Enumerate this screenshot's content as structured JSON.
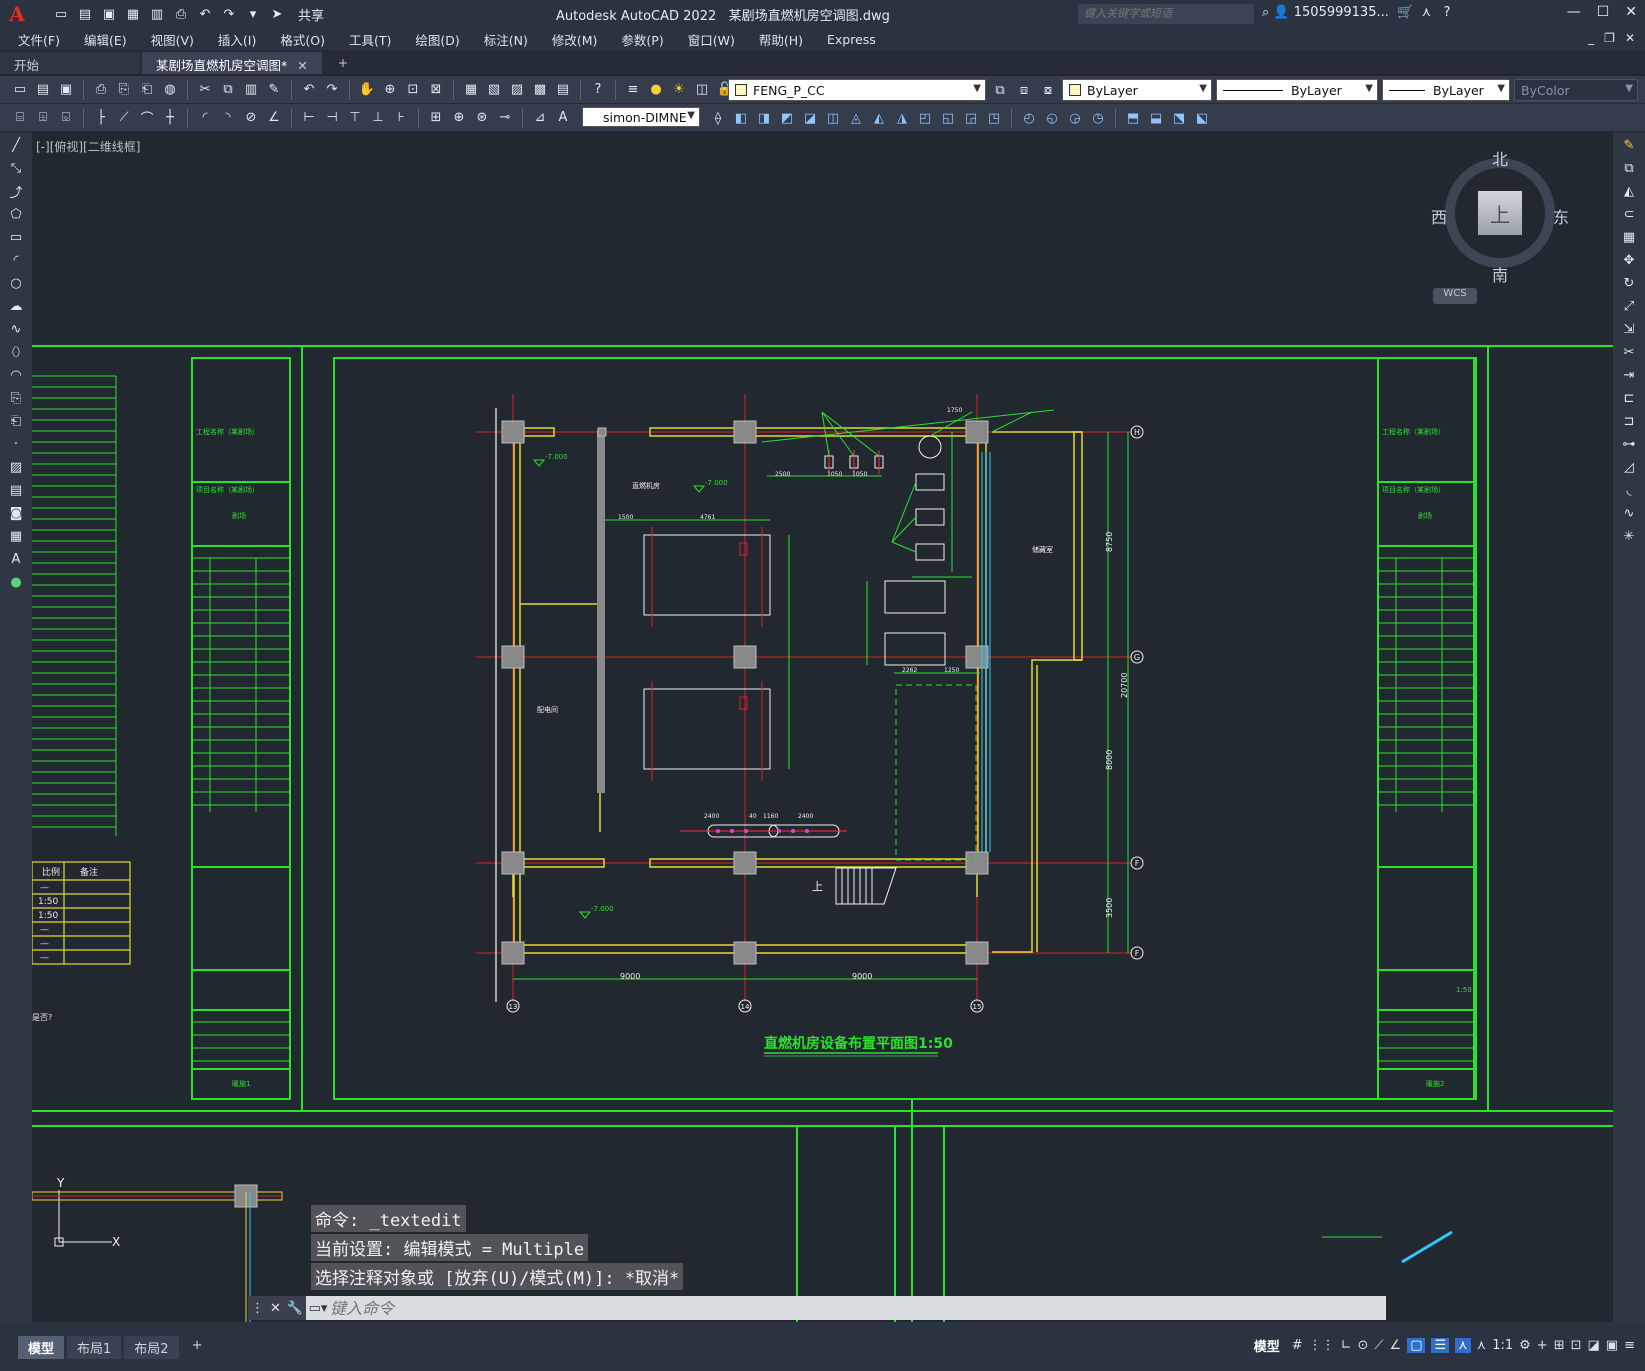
{
  "app": {
    "title": "Autodesk AutoCAD 2022",
    "filename": "某剧场直燃机房空调图.dwg",
    "search_placeholder": "键入关键字或短语",
    "account": "1505999135...",
    "share": "共享"
  },
  "menu": [
    "文件(F)",
    "编辑(E)",
    "视图(V)",
    "插入(I)",
    "格式(O)",
    "工具(T)",
    "绘图(D)",
    "标注(N)",
    "修改(M)",
    "参数(P)",
    "窗口(W)",
    "帮助(H)",
    "Express"
  ],
  "tabs": [
    {
      "label": "开始"
    },
    {
      "label": "某剧场直燃机房空调图*"
    }
  ],
  "toolbar": {
    "layer": "FENG_P_CC",
    "color": "ByLayer",
    "linetype": "ByLayer",
    "lineweight": "ByLayer",
    "plotstyle": "ByColor",
    "dimstyle": "simon-DIMNE"
  },
  "viewport_label": "[-][俯视][二维线框]",
  "viewcube": {
    "north": "北",
    "south": "南",
    "east": "东",
    "west": "西",
    "face": "上",
    "wcs": "WCS"
  },
  "drawing": {
    "title": "直燃机房设备布置平面图1:50",
    "axis_labels": [
      "H",
      "G",
      "F",
      "F",
      "13",
      "14",
      "15"
    ],
    "dims_bottom": [
      "9000",
      "9000"
    ],
    "dims_right": [
      "8750",
      "20700",
      "8000",
      "3500"
    ],
    "elevations": [
      "-7.000",
      "-7.000",
      "-7.000"
    ],
    "room_labels": [
      "直燃机房",
      "配电间",
      "储藏室",
      "上"
    ],
    "top_dims": [
      "2500",
      "1050",
      "1050",
      "1750",
      "1500",
      "4761"
    ],
    "mid_dims": [
      "2400",
      "40",
      "1160",
      "2400",
      "2262",
      "1250"
    ],
    "left_table": {
      "header": [
        "比例",
        "备注"
      ],
      "rows": [
        "—",
        "1:50",
        "1:50",
        "—",
        "—",
        "—"
      ]
    },
    "left_note": "是否?",
    "titleblock_left": {
      "title1": "工程名称（某剧场）",
      "title2": "项目名称（某剧场）",
      "item": "剧场",
      "drawing_no": "暖施1"
    },
    "titleblock_right": {
      "title1": "工程名称（某剧场）",
      "title2": "项目名称（某剧场）",
      "item": "剧场",
      "drawing_no": "暖施2",
      "scale": "1:50"
    }
  },
  "command": {
    "history": [
      "命令: _textedit",
      "当前设置: 编辑模式 = Multiple",
      "选择注释对象或 [放弃(U)/模式(M)]: *取消*"
    ],
    "placeholder": "键入命令"
  },
  "layout_tabs": [
    "模型",
    "布局1",
    "布局2"
  ],
  "status": {
    "model": "模型",
    "scale": "1:1"
  }
}
